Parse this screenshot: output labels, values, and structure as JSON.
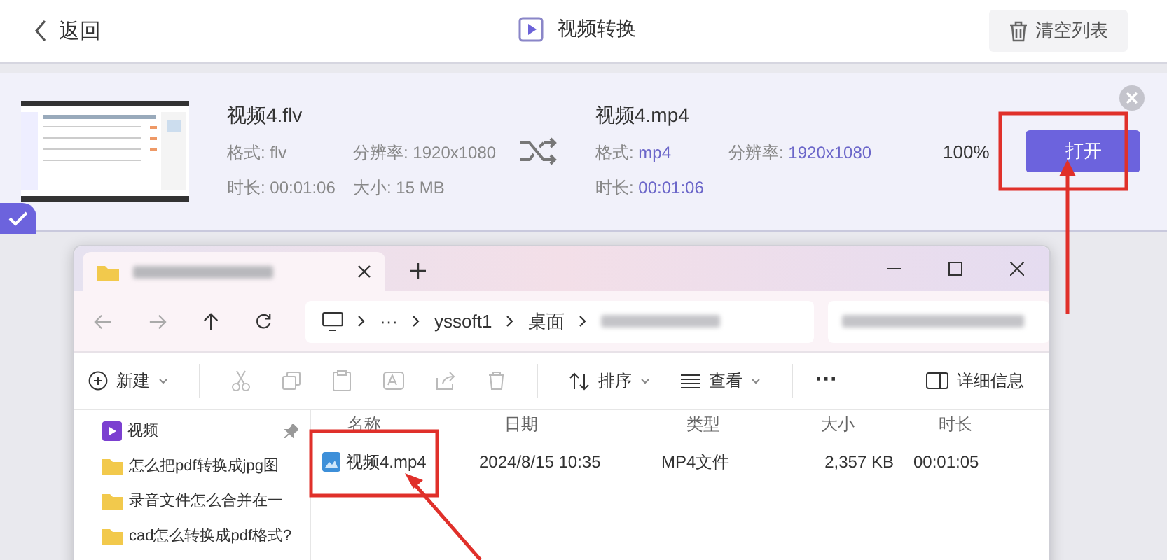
{
  "header": {
    "back": "返回",
    "title": "视频转换",
    "clear": "清空列表"
  },
  "task": {
    "checked": true,
    "source": {
      "name": "视频4.flv",
      "fields": [
        {
          "label": "格式:",
          "value": "flv"
        },
        {
          "label": "分辨率:",
          "value": "1920x1080"
        },
        {
          "label": "时长:",
          "value": "00:01:06"
        },
        {
          "label": "大小:",
          "value": "15 MB"
        }
      ]
    },
    "output": {
      "name": "视频4.mp4",
      "fields": [
        {
          "label": "格式:",
          "value": "mp4"
        },
        {
          "label": "分辨率:",
          "value": "1920x1080"
        },
        {
          "label": "时长:",
          "value": "00:01:06"
        }
      ]
    },
    "progress": "100%",
    "open": "打开"
  },
  "explorer": {
    "address": [
      "···",
      "yssoft1",
      "桌面"
    ],
    "new": "新建",
    "sort": "排序",
    "view": "查看",
    "more": "···",
    "details": "详细信息",
    "nav": [
      {
        "kind": "video",
        "label": "视频",
        "pinned": true
      },
      {
        "kind": "folder",
        "label": "怎么把pdf转换成jpg图"
      },
      {
        "kind": "folder",
        "label": "录音文件怎么合并在一"
      },
      {
        "kind": "folder",
        "label": "cad怎么转换成pdf格式?"
      }
    ],
    "columns": [
      "名称",
      "日期",
      "类型",
      "大小",
      "时长"
    ],
    "rows": [
      {
        "cells": [
          "视频4.mp4",
          "2024/8/15 10:35",
          "MP4文件",
          "2,357 KB",
          "00:01:05"
        ]
      }
    ]
  }
}
